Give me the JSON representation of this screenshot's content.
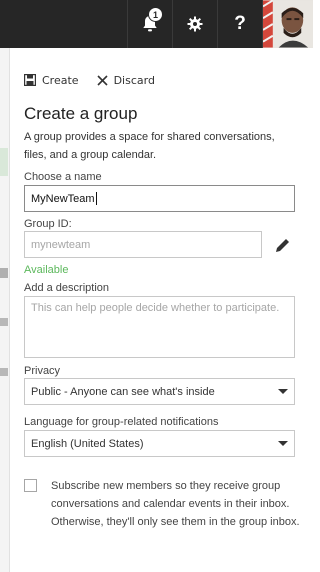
{
  "topbar": {
    "notification_count": "1",
    "help_label": "?",
    "icons": [
      "bell-icon",
      "gear-icon",
      "question-icon",
      "avatar"
    ]
  },
  "commands": {
    "create_label": "Create",
    "discard_label": "Discard"
  },
  "form": {
    "title": "Create a group",
    "description": "A group provides a space for shared conversations, files, and a group calendar.",
    "name_label": "Choose a name",
    "name_value": "MyNewTeam",
    "groupid_label": "Group ID:",
    "groupid_placeholder": "mynewteam",
    "availability": "Available",
    "description_label": "Add a description",
    "description_placeholder": "This can help people decide whether to participate.",
    "privacy_label": "Privacy",
    "privacy_value": "Public - Anyone can see what's inside",
    "language_label": "Language for group-related notifications",
    "language_value": "English (United States)",
    "subscribe_text": "Subscribe new members so they receive group conversations and calendar events in their inbox. Otherwise, they'll only see them in the group inbox.",
    "subscribe_checked": false
  },
  "colors": {
    "topbar": "#262626",
    "available": "#5cb85c",
    "border": "#c8c8c8"
  }
}
